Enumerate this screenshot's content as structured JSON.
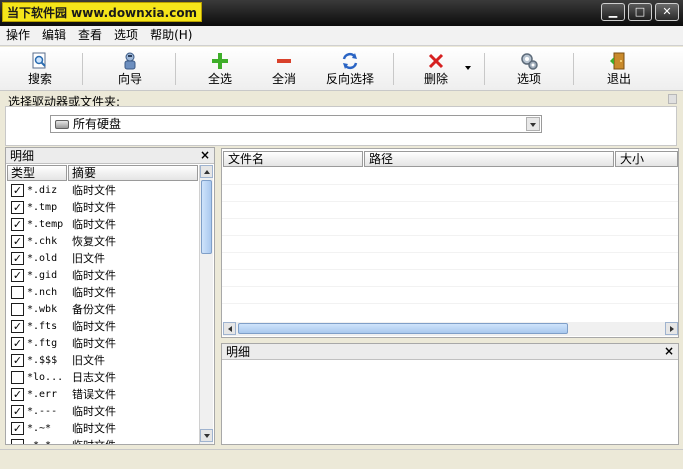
{
  "window": {
    "brand": "当下软件园 www.downxia.com",
    "controls": {
      "minimize": "▁",
      "maximize": "□",
      "close": "✕"
    }
  },
  "menu": [
    {
      "label": "操作"
    },
    {
      "label": "编辑"
    },
    {
      "label": "查看"
    },
    {
      "label": "选项"
    },
    {
      "label": "帮助(H)"
    }
  ],
  "toolbar": {
    "search": "搜索",
    "wizard": "向导",
    "select_all": "全选",
    "deselect_all": "全消",
    "invert": "反向选择",
    "delete": "删除",
    "options": "选项",
    "exit": "退出"
  },
  "drive": {
    "label": "选择驱动器或文件夹:",
    "selected": "所有硬盘"
  },
  "left_panel": {
    "title": "明细",
    "close": "×",
    "columns": {
      "type": "类型",
      "desc": "摘要"
    },
    "rows": [
      {
        "checked": true,
        "ext": "*.diz",
        "desc": "临时文件"
      },
      {
        "checked": true,
        "ext": "*.tmp",
        "desc": "临时文件"
      },
      {
        "checked": true,
        "ext": "*.temp",
        "desc": "临时文件"
      },
      {
        "checked": true,
        "ext": "*.chk",
        "desc": "恢复文件"
      },
      {
        "checked": true,
        "ext": "*.old",
        "desc": "旧文件"
      },
      {
        "checked": true,
        "ext": "*.gid",
        "desc": "临时文件"
      },
      {
        "checked": false,
        "ext": "*.nch",
        "desc": "临时文件"
      },
      {
        "checked": false,
        "ext": "*.wbk",
        "desc": "备份文件"
      },
      {
        "checked": true,
        "ext": "*.fts",
        "desc": "临时文件"
      },
      {
        "checked": true,
        "ext": "*.ftg",
        "desc": "临时文件"
      },
      {
        "checked": true,
        "ext": "*.$$$",
        "desc": "旧文件"
      },
      {
        "checked": false,
        "ext": "*lo...",
        "desc": "日志文件"
      },
      {
        "checked": true,
        "ext": "*.err",
        "desc": "错误文件"
      },
      {
        "checked": true,
        "ext": "*.---",
        "desc": "临时文件"
      },
      {
        "checked": true,
        "ext": "*.~*",
        "desc": "临时文件"
      },
      {
        "checked": false,
        "ext": "~*.*",
        "desc": "临时文件"
      }
    ]
  },
  "file_list": {
    "columns": {
      "name": "文件名",
      "path": "路径",
      "size": "大小"
    }
  },
  "detail_panel": {
    "title": "明细",
    "close": "×"
  }
}
